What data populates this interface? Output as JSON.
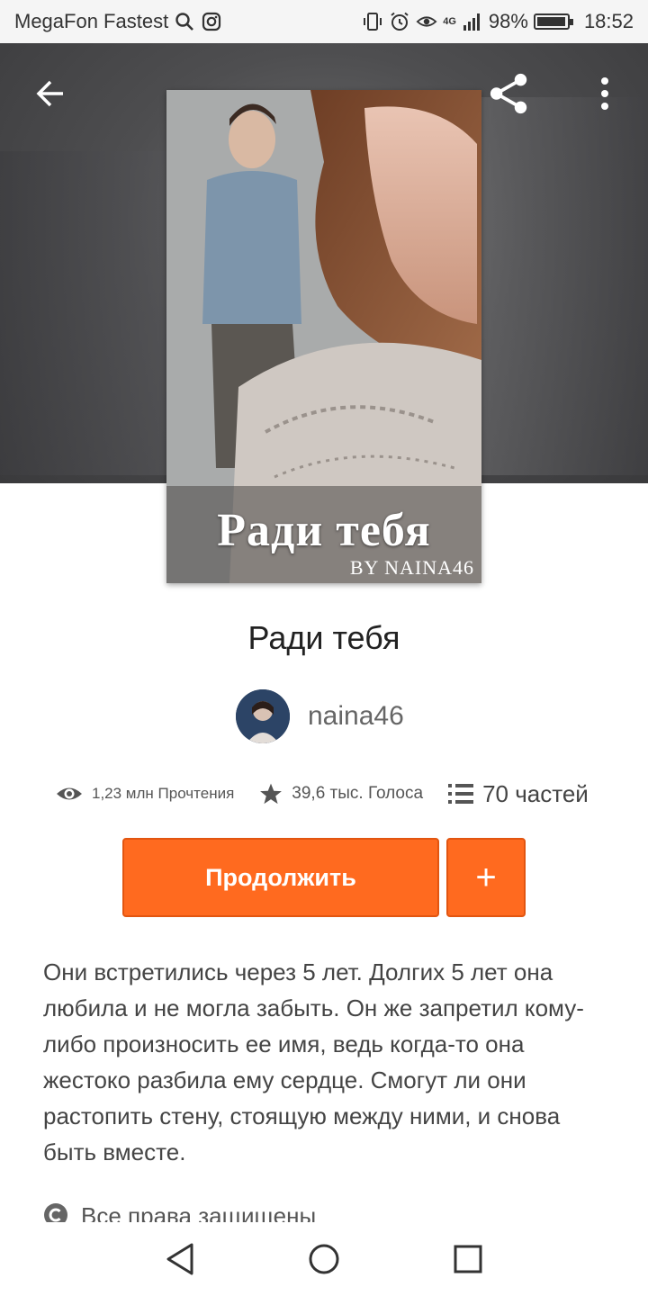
{
  "status_bar": {
    "carrier": "MegaFon Fastest",
    "network": "4G",
    "battery": "98%",
    "battery_level": 0.98,
    "time": "18:52"
  },
  "header": {
    "back_icon": "arrow-left-icon",
    "share_icon": "share-icon",
    "menu_icon": "more-vert-icon"
  },
  "cover": {
    "title_text": "Ради тебя",
    "byline_text": "BY NAINA46"
  },
  "story": {
    "title": "Ради тебя",
    "author": "naina46"
  },
  "stats": {
    "reads": "1,23 млн Прочтения",
    "votes": "39,6 тыс. Голоса",
    "parts": "70 частей"
  },
  "actions": {
    "continue_label": "Продолжить",
    "add_label": "+"
  },
  "description": "Они встретились через 5 лет. Долгих 5 лет она любила и  не могла забыть. Он же запретил кому-либо произносить ее имя, ведь когда-то она  жестоко разбила  ему сердце. Смогут ли они растопить стену, стоящую между ними, и снова быть вместе.",
  "rights": "Все права защищены",
  "colors": {
    "accent": "#ff6a1f"
  }
}
